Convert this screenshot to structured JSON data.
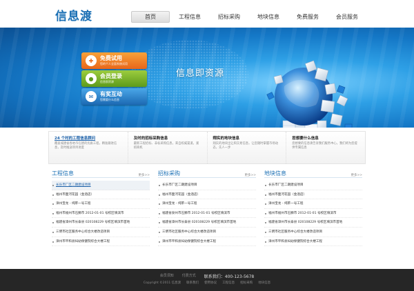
{
  "header": {
    "logo": "信息渡",
    "nav": [
      "首页",
      "工程信息",
      "招标采购",
      "地块信息",
      "免费服务",
      "会员服务"
    ]
  },
  "banner": {
    "slogan": "信息即资源",
    "buttons": [
      {
        "title": "免费试用",
        "sub": "您的个人全面系统试用",
        "icon": "gift-icon"
      },
      {
        "title": "会员登录",
        "sub": "信息即资源",
        "icon": "user-icon"
      },
      {
        "title": "有奖互动",
        "sub": "您需要什么信息",
        "icon": "chat-icon"
      }
    ]
  },
  "info": [
    {
      "title": "24 个时的工程信息顾问",
      "desc": "覆盖城建省各地市在建的优质工程，精准跟进信息，及时推送项目进度"
    },
    {
      "title": "及时的招标采购信息",
      "desc": "最新工程招标、非标采购信息，来自权威渠道，紧抓商机"
    },
    {
      "title": "翔实的地块信息",
      "desc": "翔实的地块出让和交易信息，让您随时掌握市场动态，先人一步"
    },
    {
      "title": "您想要什么信息",
      "desc": "您想要的信息请告诉我们服务中心，我们将为您提供专属信息"
    }
  ],
  "columns": [
    {
      "title": "工程信息",
      "more": "更多>>",
      "items": [
        "长乐市厂区二期建设项目",
        "福州市面河花园（金酒店）",
        "漳州宝龙 - 纯苹一号工程",
        "福州市福州市石狮市 2012-01-01 号校区填滨市",
        "福建省漳州市长泰县 020108229 号校区填滨市首地",
        "三明市社区服务中心综合大楼改造项目",
        "漳州市平和县妇幼保健院综合大楼工程"
      ]
    },
    {
      "title": "招标采购",
      "more": "更多>>",
      "items": [
        "长乐市厂区二期建设项目",
        "福州市面河花园（金酒店）",
        "漳州宝龙 - 纯苹一号工程",
        "福建省泉州市石狮市 2012-01-01 号校区填滨市",
        "福建省漳州市长泰县 020108229 号校区填滨市首地",
        "三明市社区服务中心综合大楼改造项目",
        "漳州市平和县妇幼保健院综合大楼工程"
      ]
    },
    {
      "title": "地块信息",
      "more": "更多>>",
      "items": [
        "长乐市厂区二期建设项目",
        "福州市面河花园（金酒店）",
        "漳州宝龙 - 纯苹一号工程",
        "福州市福州市石狮市 2012-01-01 号校区填滨市",
        "福建省漳州市长泰县 020108229 号校区填滨市首地",
        "三明市社区服务中心综合大楼改造项目",
        "漳州市平和县妇幼保健院综合大楼工程"
      ]
    }
  ],
  "footer": {
    "links_top": [
      "会员须知",
      "付费方式"
    ],
    "hotline": "联系我们：400-123-5678",
    "copyright": "Copyright ©2011 信息渡",
    "links_bottom": [
      "联系我们",
      "使用协议",
      "工程信息",
      "招标采购",
      "地块信息"
    ]
  }
}
